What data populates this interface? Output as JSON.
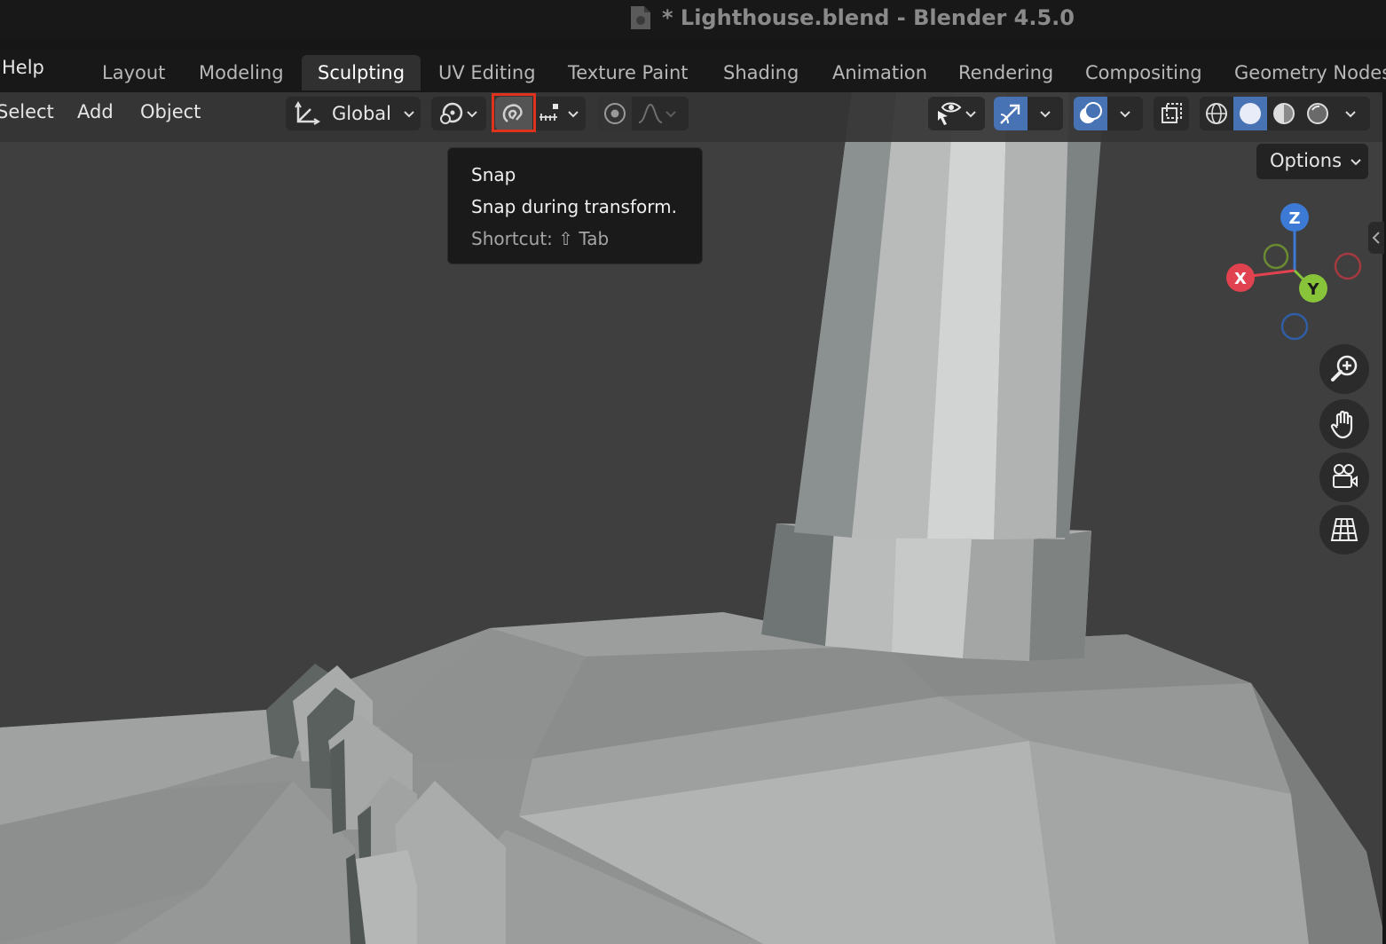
{
  "window": {
    "title": "* Lighthouse.blend - Blender 4.5.0"
  },
  "topbar": {
    "help_label": "Help"
  },
  "workspace_tabs": [
    "Layout",
    "Modeling",
    "Sculpting",
    "UV Editing",
    "Texture Paint",
    "Shading",
    "Animation",
    "Rendering",
    "Compositing",
    "Geometry Nodes"
  ],
  "active_tab": "Sculpting",
  "viewport_header": {
    "menus": {
      "select": "Select",
      "add": "Add",
      "object": "Object"
    },
    "transform_orientation": "Global"
  },
  "tooltip": {
    "title": "Snap",
    "description": "Snap during transform.",
    "shortcut": "Shortcut: ⇧ Tab"
  },
  "options_label": "Options",
  "gizmo": {
    "x": "X",
    "y": "Y",
    "z": "Z"
  },
  "colors": {
    "accent": "#4772b3",
    "highlight": "#e0331e",
    "x_axis": "#e0434f",
    "y_axis": "#88c43a",
    "z_axis": "#3d7ad6"
  }
}
